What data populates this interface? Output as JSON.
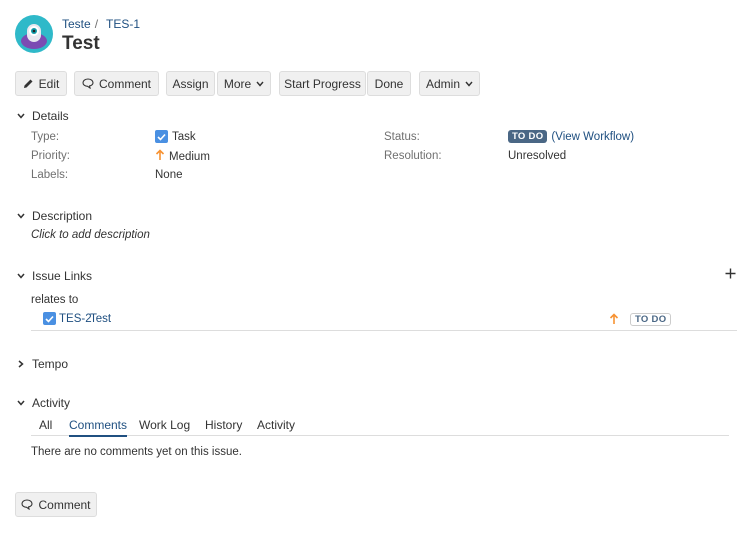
{
  "breadcrumb": {
    "project": "Teste",
    "separator": "/",
    "issue_key": "TES-1"
  },
  "issue": {
    "title": "Test"
  },
  "toolbar": {
    "edit": "Edit",
    "comment": "Comment",
    "assign": "Assign",
    "more": "More",
    "start_progress": "Start Progress",
    "done": "Done",
    "admin": "Admin"
  },
  "details": {
    "heading": "Details",
    "type_label": "Type:",
    "type_value": "Task",
    "priority_label": "Priority:",
    "priority_value": "Medium",
    "labels_label": "Labels:",
    "labels_value": "None",
    "status_label": "Status:",
    "status_value": "TO DO",
    "view_workflow": "(View Workflow)",
    "resolution_label": "Resolution:",
    "resolution_value": "Unresolved"
  },
  "description": {
    "heading": "Description",
    "placeholder": "Click to add description"
  },
  "issue_links": {
    "heading": "Issue Links",
    "add_icon": "plus-icon",
    "relation": "relates to",
    "link_key": "TES-2",
    "link_summary": "Test",
    "link_status": "TO DO"
  },
  "tempo": {
    "heading": "Tempo"
  },
  "activity": {
    "heading": "Activity",
    "tabs": [
      "All",
      "Comments",
      "Work Log",
      "History",
      "Activity"
    ],
    "active_tab": "Comments",
    "empty_message": "There are no comments yet on this issue."
  },
  "footer": {
    "comment": "Comment"
  },
  "colors": {
    "link": "#205081",
    "lozenge": "#4a6785",
    "priority": "#f79232",
    "task": "#4a90e2"
  }
}
